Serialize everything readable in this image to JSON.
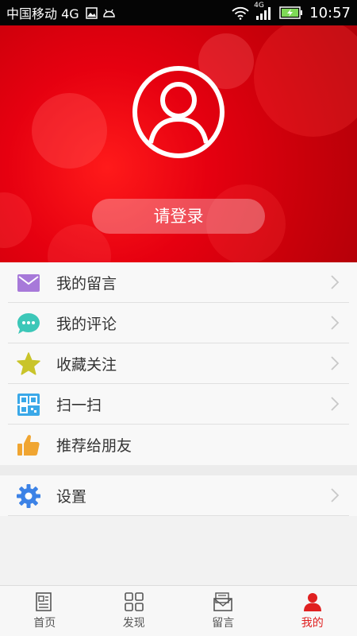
{
  "status_bar": {
    "carrier": "中国移动 4G",
    "network_label": "4G",
    "time": "10:57"
  },
  "profile": {
    "login_label": "请登录"
  },
  "menu": {
    "items": [
      {
        "label": "我的留言",
        "icon": "mail-icon",
        "color": "#a779d9"
      },
      {
        "label": "我的评论",
        "icon": "comment-icon",
        "color": "#3cc7b8"
      },
      {
        "label": "收藏关注",
        "icon": "star-icon",
        "color": "#c9c42a"
      },
      {
        "label": "扫一扫",
        "icon": "qr-scan-icon",
        "color": "#3aa8e8"
      },
      {
        "label": "推荐给朋友",
        "icon": "thumbs-up-icon",
        "color": "#f0a531"
      }
    ],
    "settings": {
      "label": "设置",
      "icon": "gear-icon",
      "color": "#3c82e6"
    }
  },
  "tabbar": {
    "tabs": [
      {
        "label": "首页",
        "icon": "home-doc-icon"
      },
      {
        "label": "发现",
        "icon": "grid-icon"
      },
      {
        "label": "留言",
        "icon": "message-icon"
      },
      {
        "label": "我的",
        "icon": "user-icon",
        "active": true
      }
    ]
  },
  "colors": {
    "brand": "#e60010",
    "active_tab": "#e02020"
  }
}
